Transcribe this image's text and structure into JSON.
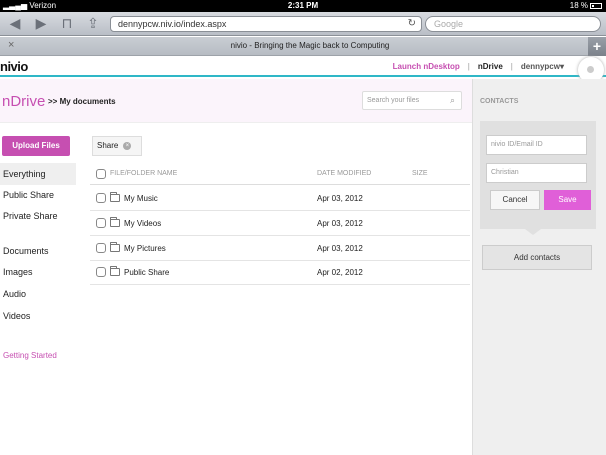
{
  "status_bar": {
    "carrier": "Verizon",
    "time": "2:31 PM",
    "battery": "18 %"
  },
  "browser": {
    "url": "dennypcw.niv.io/index.aspx",
    "search_placeholder": "Google",
    "tab_title": "nivio - Bringing the Magic back to Computing"
  },
  "app": {
    "logo": "nivio",
    "nav": {
      "launch": "Launch nDesktop",
      "ndrive": "nDrive",
      "user": "dennypcw"
    }
  },
  "page": {
    "title": "nDrive",
    "breadcrumb": ">> My documents",
    "search_placeholder": "Search your files"
  },
  "sidebar": {
    "upload_label": "Upload Files",
    "items": [
      {
        "label": "Everything"
      },
      {
        "label": "Public Share"
      },
      {
        "label": "Private Share"
      },
      {
        "label": "Documents"
      },
      {
        "label": "Images"
      },
      {
        "label": "Audio"
      },
      {
        "label": "Videos"
      }
    ],
    "getting_started": "Getting Started"
  },
  "files": {
    "share_label": "Share",
    "columns": {
      "name": "FILE/FOLDER NAME",
      "date": "DATE MODIFIED",
      "size": "SIZE"
    },
    "rows": [
      {
        "name": "My Music",
        "date": "Apr 03, 2012",
        "size": ""
      },
      {
        "name": "My Videos",
        "date": "Apr 03, 2012",
        "size": ""
      },
      {
        "name": "My Pictures",
        "date": "Apr 03, 2012",
        "size": ""
      },
      {
        "name": "Public Share",
        "date": "Apr 02, 2012",
        "size": ""
      }
    ]
  },
  "contacts": {
    "title": "CONTACTS",
    "id_placeholder": "nivio ID/Email ID",
    "name_value": "Christian",
    "cancel_label": "Cancel",
    "save_label": "Save",
    "add_label": "Add contacts"
  },
  "colors": {
    "accent": "#c64fb1",
    "save": "#e05fd8",
    "header_rule": "#2fb7c7"
  }
}
